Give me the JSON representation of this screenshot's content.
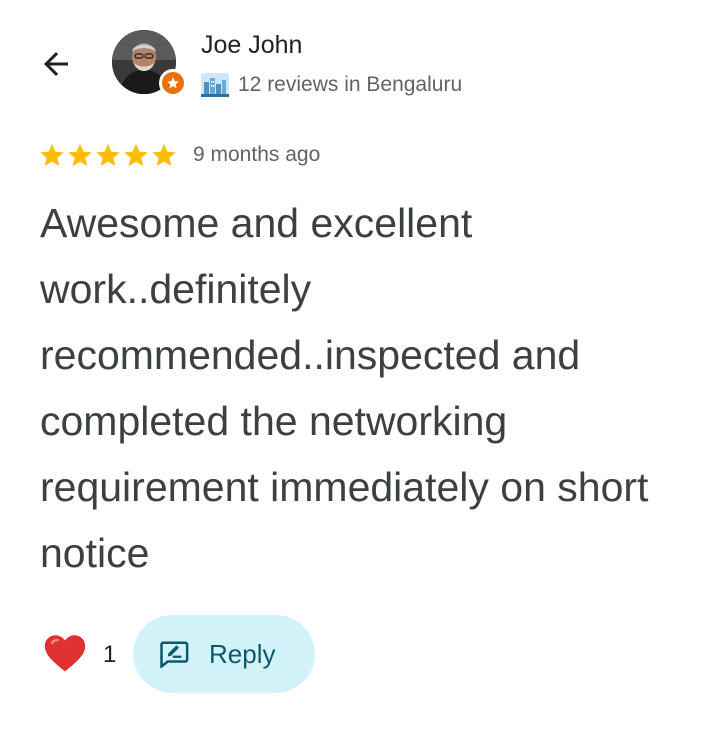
{
  "reviewer": {
    "name": "Joe John",
    "reviews_summary": "12 reviews in Bengaluru"
  },
  "rating": {
    "stars": 5,
    "max": 5,
    "time_ago": "9 months ago"
  },
  "review": {
    "text": "Awesome and excellent work..definitely recommended..inspected and completed the networking requirement immediately on short notice"
  },
  "actions": {
    "like_count": "1",
    "reply_label": "Reply"
  },
  "icons": {
    "back": "arrow-left-icon",
    "badge": "local-guide-star-icon",
    "city": "cityscape-icon",
    "star": "star-icon",
    "heart": "heart-icon",
    "reply": "reply-icon"
  },
  "colors": {
    "star": "#fbbc04",
    "badge": "#e8710a",
    "reply_bg": "#d3f3fb",
    "reply_text": "#0b5a6b",
    "heart": "#e03131"
  }
}
